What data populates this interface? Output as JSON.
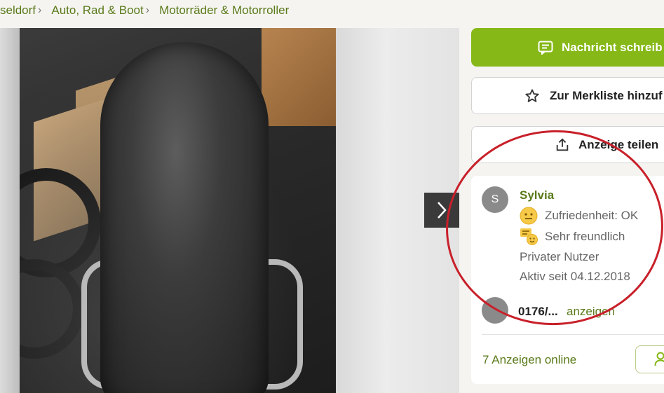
{
  "breadcrumb": [
    {
      "label": "seldorf"
    },
    {
      "label": "Auto, Rad & Boot"
    },
    {
      "label": "Motorräder & Motorroller"
    }
  ],
  "gallery": {
    "next_icon": "chevron-right-icon"
  },
  "actions": {
    "message_label": "Nachricht schreib",
    "watchlist_label": "Zur Merkliste hinzuf",
    "share_label": "Anzeige teilen"
  },
  "seller": {
    "initial": "S",
    "name": "Sylvia",
    "satisfaction": "Zufriedenheit: OK",
    "friendliness": "Sehr freundlich",
    "type": "Privater Nutzer",
    "active_since": "Aktiv seit 04.12.2018",
    "phone_initial": "",
    "phone": "0176/...",
    "phone_reveal": "anzeigen",
    "ads_online": "7 Anzeigen online"
  },
  "colors": {
    "accent": "#86b817",
    "link": "#5a7a1a",
    "annotation": "#c8202a"
  }
}
